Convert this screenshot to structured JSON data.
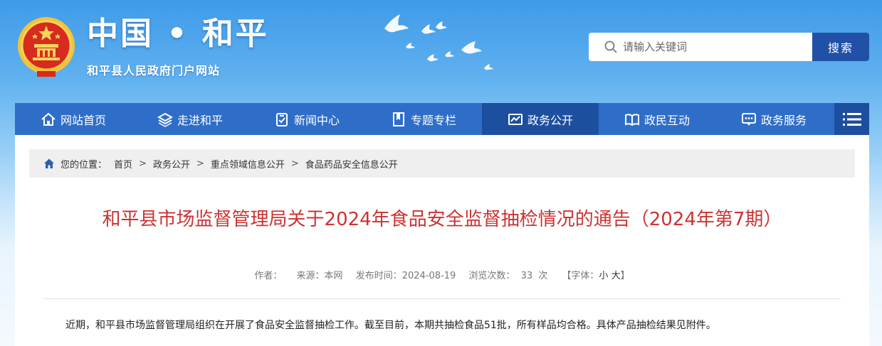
{
  "header": {
    "site_title": "中国 • 和平",
    "site_subtitle": "和平县人民政府门户网站",
    "emblem_icon": "national-emblem-icon"
  },
  "search": {
    "placeholder": "请输入关键词",
    "button_label": "搜索"
  },
  "nav": {
    "items": [
      {
        "label": "网站首页",
        "icon": "home-icon"
      },
      {
        "label": "走进和平",
        "icon": "layers-icon"
      },
      {
        "label": "新闻中心",
        "icon": "document-check-icon"
      },
      {
        "label": "专题专栏",
        "icon": "bookmark-icon"
      },
      {
        "label": "政务公开",
        "icon": "chart-icon",
        "active": true
      },
      {
        "label": "政民互动",
        "icon": "book-icon"
      },
      {
        "label": "政务服务",
        "icon": "chat-icon"
      }
    ],
    "more_icon": "menu-icon"
  },
  "breadcrumb": {
    "label": "您的位置：",
    "items": [
      "首页",
      "政务公开",
      "重点领域信息公开",
      "食品药品安全信息公开"
    ],
    "separator": ">"
  },
  "article": {
    "title": "和平县市场监督管理局关于2024年食品安全监督抽检情况的通告（2024年第7期）",
    "meta": {
      "author_label": "作者：",
      "source_label": "来源：本网",
      "date_label": "发布时间：2024-08-19",
      "views_label": "浏览次数：",
      "views": "33",
      "views_unit": "次",
      "font_label": "【字体：",
      "font_small": "小",
      "font_large": "大",
      "font_close": "】"
    },
    "body": "近期，和平县市场监督管理局组织在开展了食品安全监督抽检工作。截至目前，本期共抽检食品51批，所有样品均合格。具体产品抽检结果见附件。"
  },
  "colors": {
    "nav_bg": "#2f6ec8",
    "nav_active": "#1d4f9f",
    "title_red": "#cc3333",
    "search_button": "#2151a6"
  }
}
